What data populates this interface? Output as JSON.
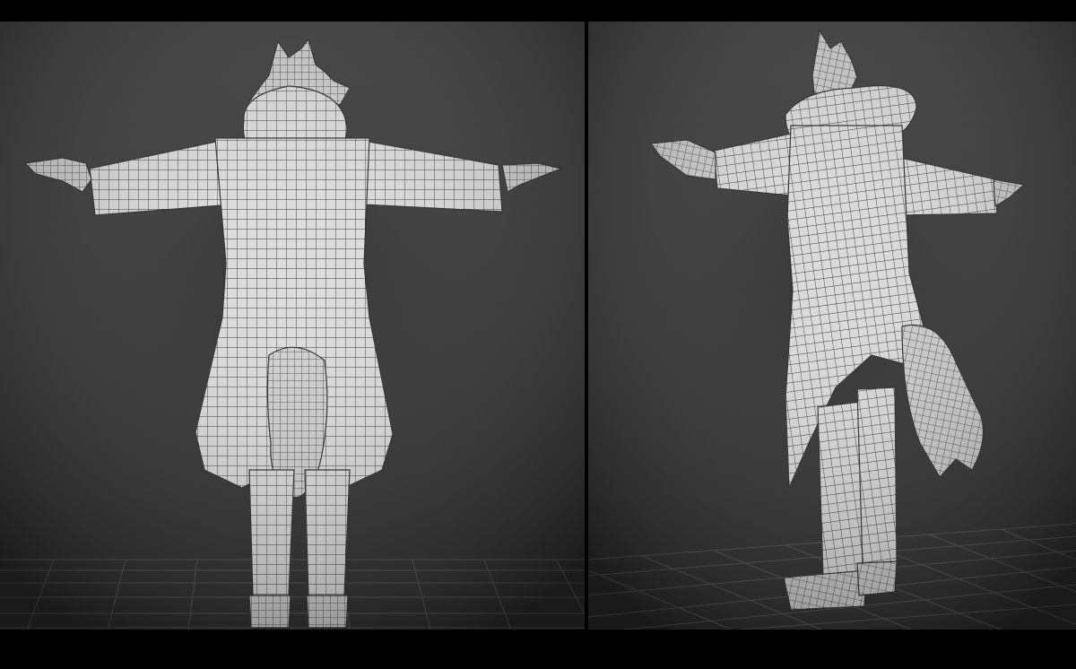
{
  "viewports": [
    {
      "view": "back",
      "background_top": "#3a3a3a",
      "background_bottom": "#262626",
      "grid_color": "#4e4e4e"
    },
    {
      "view": "three-quarter",
      "background_top": "#3a3a3a",
      "background_bottom": "#262626",
      "grid_color": "#4e4e4e"
    }
  ],
  "model": {
    "surface_color": "#d9d9d9",
    "shade_color": "#9a9a9a",
    "wire_color": "#2a2a2a"
  },
  "letterbox_color": "#000000"
}
